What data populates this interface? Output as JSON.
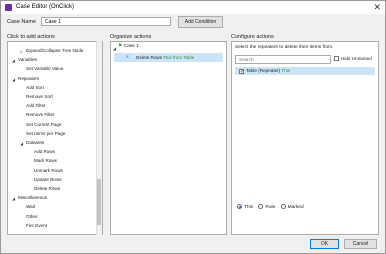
{
  "window": {
    "title": "Case Editor (OnClick)",
    "close_glyph": "✕",
    "icon": "axure-app-icon"
  },
  "case_name": {
    "label": "Case Name",
    "value": "Case 1"
  },
  "add_condition_label": "Add Condition",
  "left_pane": {
    "label": "Click to add actions",
    "items": [
      {
        "text": "Expand/Collapse Tree Node",
        "level": 1,
        "expander": "▷"
      },
      {
        "text": "Variables",
        "level": 0,
        "expander": "◢"
      },
      {
        "text": "Set Variable Value",
        "level": 1,
        "expander": ""
      },
      {
        "text": "Repeaters",
        "level": 0,
        "expander": "◢"
      },
      {
        "text": "Add Sort",
        "level": 1,
        "expander": ""
      },
      {
        "text": "Remove Sort",
        "level": 1,
        "expander": ""
      },
      {
        "text": "Add Filter",
        "level": 1,
        "expander": ""
      },
      {
        "text": "Remove Filter",
        "level": 1,
        "expander": ""
      },
      {
        "text": "Set Current Page",
        "level": 1,
        "expander": ""
      },
      {
        "text": "Set Items per Page",
        "level": 1,
        "expander": ""
      },
      {
        "text": "Datasets",
        "level": 1,
        "expander": "◢"
      },
      {
        "text": "Add Rows",
        "level": 2,
        "expander": ""
      },
      {
        "text": "Mark Rows",
        "level": 2,
        "expander": ""
      },
      {
        "text": "Unmark Rows",
        "level": 2,
        "expander": ""
      },
      {
        "text": "Update Rows",
        "level": 2,
        "expander": ""
      },
      {
        "text": "Delete Rows",
        "level": 2,
        "expander": ""
      },
      {
        "text": "Miscellaneous",
        "level": 0,
        "expander": "◢"
      },
      {
        "text": "Wait",
        "level": 1,
        "expander": ""
      },
      {
        "text": "Other",
        "level": 1,
        "expander": ""
      },
      {
        "text": "Fire Event",
        "level": 1,
        "expander": ""
      }
    ]
  },
  "middle_pane": {
    "label": "Organize actions",
    "case_expander": "◢",
    "case_label": "Case 1",
    "action_prefix": "Delete Rows",
    "action_target": "This from Table"
  },
  "right_pane": {
    "label": "Configure actions",
    "instruction": "Select the repeaters to delete their items from.",
    "search_placeholder": "Search",
    "hide_unnamed_label": "Hide Unnamed",
    "hide_unnamed_checked": false,
    "repeater_label": "Table (Repeater)",
    "repeater_suffix": "This",
    "repeater_checked": true,
    "radio_options": [
      {
        "label": "This",
        "selected": true
      },
      {
        "label": "Rule",
        "selected": false
      },
      {
        "label": "Marked",
        "selected": false
      }
    ]
  },
  "footer": {
    "ok_label": "OK",
    "cancel_label": "Cancel"
  },
  "colors": {
    "selection": "#cce4f7",
    "green_text": "#2a8a2a",
    "app_icon": "#6b2fa3"
  }
}
